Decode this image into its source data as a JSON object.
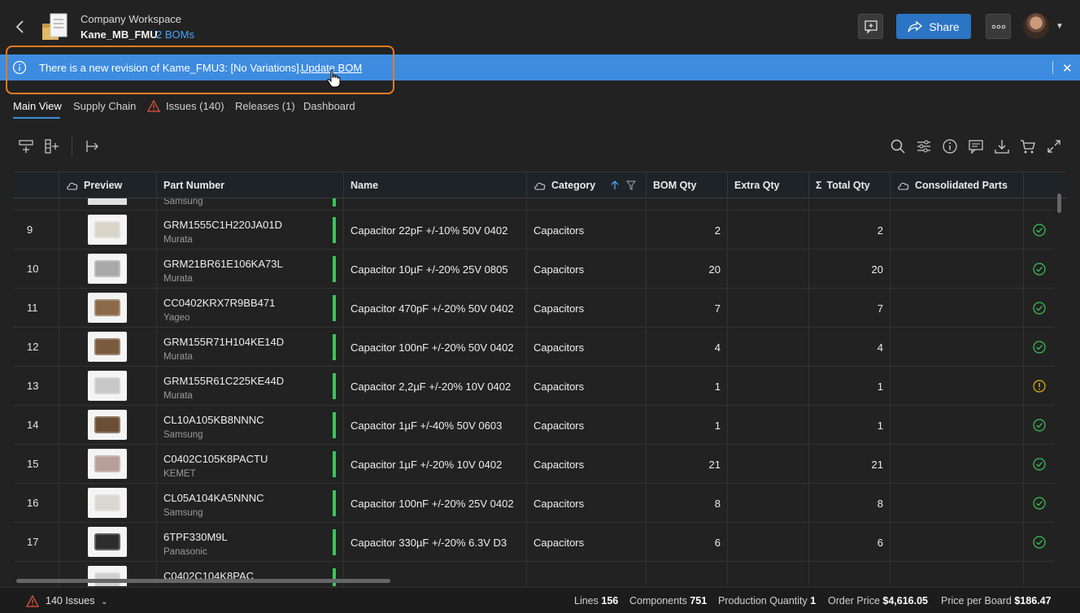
{
  "header": {
    "workspace": "Company Workspace",
    "project": "Kane_MB_FMU",
    "boms_link": "2 BOMs",
    "share_label": "Share"
  },
  "banner": {
    "text": "There is a new revision of Kame_FMU3: [No Variations].",
    "link": "Update BOM",
    "color": "#3d8ce0"
  },
  "tabs": [
    {
      "label": "Main View"
    },
    {
      "label": "Supply Chain"
    },
    {
      "label": "Issues (140)"
    },
    {
      "label": "Releases (1)"
    },
    {
      "label": "Dashboard"
    }
  ],
  "columns": {
    "preview": "Preview",
    "part_number": "Part Number",
    "name": "Name",
    "category": "Category",
    "bom_qty": "BOM Qty",
    "extra_qty": "Extra Qty",
    "total_qty": "Total Qty",
    "consolidated": "Consolidated Parts"
  },
  "partial_top_mfr": "Samsung",
  "rows": [
    {
      "num": "9",
      "pn": "GRM1555C1H220JA01D",
      "mfr": "Murata",
      "name": "Capacitor 22pF +/-10% 50V 0402",
      "cat": "Capacitors",
      "bom": "2",
      "total": "2",
      "status": "ok"
    },
    {
      "num": "10",
      "pn": "GRM21BR61E106KA73L",
      "mfr": "Murata",
      "name": "Capacitor 10µF +/-20% 25V 0805",
      "cat": "Capacitors",
      "bom": "20",
      "total": "20",
      "status": "ok"
    },
    {
      "num": "11",
      "pn": "CC0402KRX7R9BB471",
      "mfr": "Yageo",
      "name": "Capacitor 470pF +/-20% 50V 0402",
      "cat": "Capacitors",
      "bom": "7",
      "total": "7",
      "status": "ok"
    },
    {
      "num": "12",
      "pn": "GRM155R71H104KE14D",
      "mfr": "Murata",
      "name": "Capacitor 100nF +/-20% 50V 0402",
      "cat": "Capacitors",
      "bom": "4",
      "total": "4",
      "status": "ok"
    },
    {
      "num": "13",
      "pn": "GRM155R61C225KE44D",
      "mfr": "Murata",
      "name": "Capacitor 2,2µF +/-20% 10V 0402",
      "cat": "Capacitors",
      "bom": "1",
      "total": "1",
      "status": "warn"
    },
    {
      "num": "14",
      "pn": "CL10A105KB8NNNC",
      "mfr": "Samsung",
      "name": "Capacitor 1µF +/-40% 50V 0603",
      "cat": "Capacitors",
      "bom": "1",
      "total": "1",
      "status": "ok"
    },
    {
      "num": "15",
      "pn": "C0402C105K8PACTU",
      "mfr": "KEMET",
      "name": "Capacitor 1µF +/-20% 10V 0402",
      "cat": "Capacitors",
      "bom": "21",
      "total": "21",
      "status": "ok"
    },
    {
      "num": "16",
      "pn": "CL05A104KA5NNNC",
      "mfr": "Samsung",
      "name": "Capacitor 100nF +/-20% 25V 0402",
      "cat": "Capacitors",
      "bom": "8",
      "total": "8",
      "status": "ok"
    },
    {
      "num": "17",
      "pn": "6TPF330M9L",
      "mfr": "Panasonic",
      "name": "Capacitor 330µF +/-20% 6.3V D3",
      "cat": "Capacitors",
      "bom": "6",
      "total": "6",
      "status": "ok"
    },
    {
      "num": "",
      "pn": "C0402C104K8PAC",
      "mfr": "",
      "name": "",
      "cat": "",
      "bom": "",
      "total": "",
      "status": ""
    }
  ],
  "footer": {
    "issues": "140 Issues",
    "lines_label": "Lines",
    "lines_value": "156",
    "components_label": "Components",
    "components_value": "751",
    "prodqty_label": "Production Quantity",
    "prodqty_value": "1",
    "order_label": "Order Price",
    "order_value": "$4,616.05",
    "ppb_label": "Price per Board",
    "ppb_value": "$186.47"
  },
  "colors": {
    "ok": "#3bc35a",
    "warn": "#e6b400",
    "accent": "#2c74c4",
    "highlight": "#f07a1e"
  }
}
